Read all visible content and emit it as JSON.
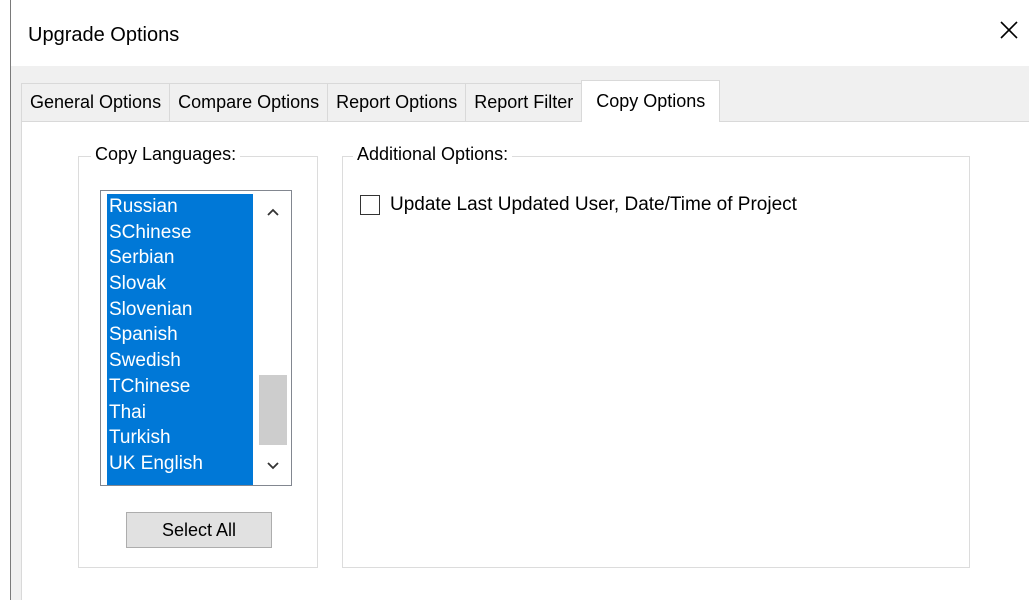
{
  "window": {
    "title": "Upgrade Options",
    "close_icon": "close-icon"
  },
  "tabs": [
    {
      "label": "General Options",
      "active": false
    },
    {
      "label": "Compare Options",
      "active": false
    },
    {
      "label": "Report Options",
      "active": false
    },
    {
      "label": "Report Filter",
      "active": false
    },
    {
      "label": "Copy Options",
      "active": true
    }
  ],
  "copy_languages": {
    "label": "Copy Languages:",
    "items": [
      "Russian",
      "SChinese",
      "Serbian",
      "Slovak",
      "Slovenian",
      "Spanish",
      "Swedish",
      "TChinese",
      "Thai",
      "Turkish",
      "UK English"
    ],
    "selection_color": "#0078d7",
    "select_all_label": "Select All",
    "scroll_up_icon": "chevron-up-icon",
    "scroll_down_icon": "chevron-down-icon"
  },
  "additional_options": {
    "label": "Additional Options:",
    "update_last_updated": {
      "label": "Update Last Updated User, Date/Time of Project",
      "checked": false
    }
  }
}
